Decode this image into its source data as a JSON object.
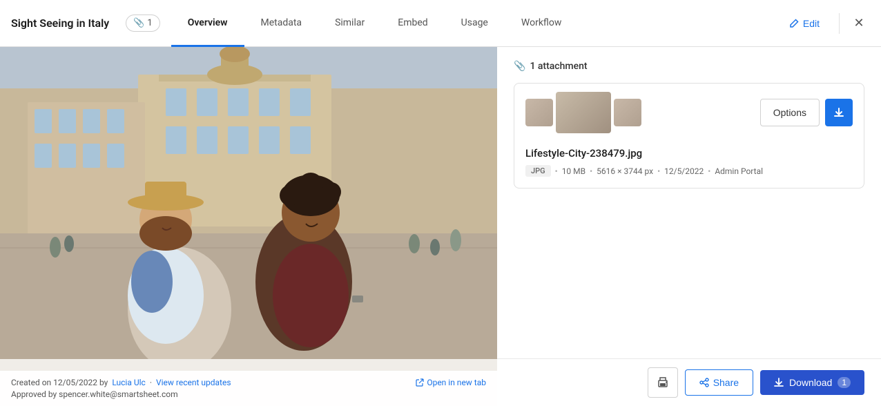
{
  "header": {
    "title": "Sight Seeing in Italy",
    "attachment_count": "1",
    "tabs": [
      {
        "id": "overview",
        "label": "Overview",
        "active": true
      },
      {
        "id": "metadata",
        "label": "Metadata",
        "active": false
      },
      {
        "id": "similar",
        "label": "Similar",
        "active": false
      },
      {
        "id": "embed",
        "label": "Embed",
        "active": false
      },
      {
        "id": "usage",
        "label": "Usage",
        "active": false
      },
      {
        "id": "workflow",
        "label": "Workflow",
        "active": false
      }
    ],
    "edit_label": "Edit"
  },
  "image_panel": {
    "created_text": "Created on 12/05/2022 by",
    "author_name": "Lucia Ulc",
    "separator": "·",
    "view_updates_label": "View recent updates",
    "approved_text": "Approved by spencer.white@smartsheet.com",
    "open_new_tab_label": "Open in new tab"
  },
  "right_panel": {
    "attachment_header": "1 attachment",
    "attachment": {
      "filename": "Lifestyle-City-238479.jpg",
      "format_badge": "JPG",
      "file_size": "10 MB",
      "dimensions": "5616 × 3744 px",
      "date": "12/5/2022",
      "source": "Admin Portal"
    },
    "options_label": "Options"
  },
  "bottom_actions": {
    "share_label": "Share",
    "download_label": "Download",
    "download_count": "1"
  },
  "icons": {
    "attachment": "🔗",
    "edit": "✏️",
    "close": "✕",
    "download": "↓",
    "print": "🖨",
    "share": "↗",
    "open_new_tab": "↗",
    "attachment_pin": "📎"
  }
}
